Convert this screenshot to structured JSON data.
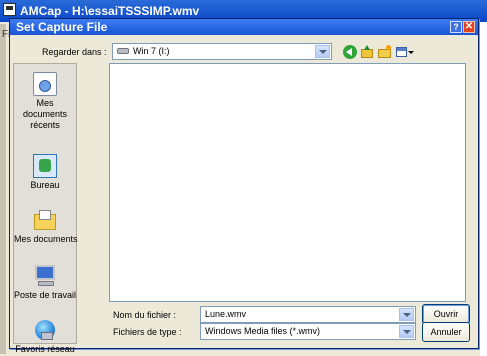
{
  "background_window": {
    "title": "AMCap - H:\\essaiTSSSIMP.wmv",
    "menu_letter": "Fi"
  },
  "dialog": {
    "title": "Set Capture File",
    "help_label": "?",
    "close_label": "✕",
    "look_in": {
      "label": "Regarder dans :",
      "value": "Win 7 (I:)"
    },
    "toolbar_icons": [
      "back-icon",
      "up-folder-icon",
      "new-folder-icon",
      "views-menu-icon"
    ],
    "places": [
      {
        "label": "Mes documents récents",
        "icon": "recent-documents-icon"
      },
      {
        "label": "Bureau",
        "icon": "desktop-icon"
      },
      {
        "label": "Mes documents",
        "icon": "my-documents-icon"
      },
      {
        "label": "Poste de travail",
        "icon": "my-computer-icon"
      },
      {
        "label": "Favoris réseau",
        "icon": "network-places-icon"
      }
    ],
    "filename": {
      "label": "Nom du fichier :",
      "value": "Lune.wmv"
    },
    "filetype": {
      "label": "Fichiers de type :",
      "value": "Windows Media files (*.wmv)"
    },
    "buttons": {
      "open": "Ouvrir",
      "cancel": "Annuler"
    }
  },
  "colors": {
    "titlebar": "#0a46c8",
    "dialog_bg": "#ece9d8",
    "close_button": "#e0451f"
  }
}
